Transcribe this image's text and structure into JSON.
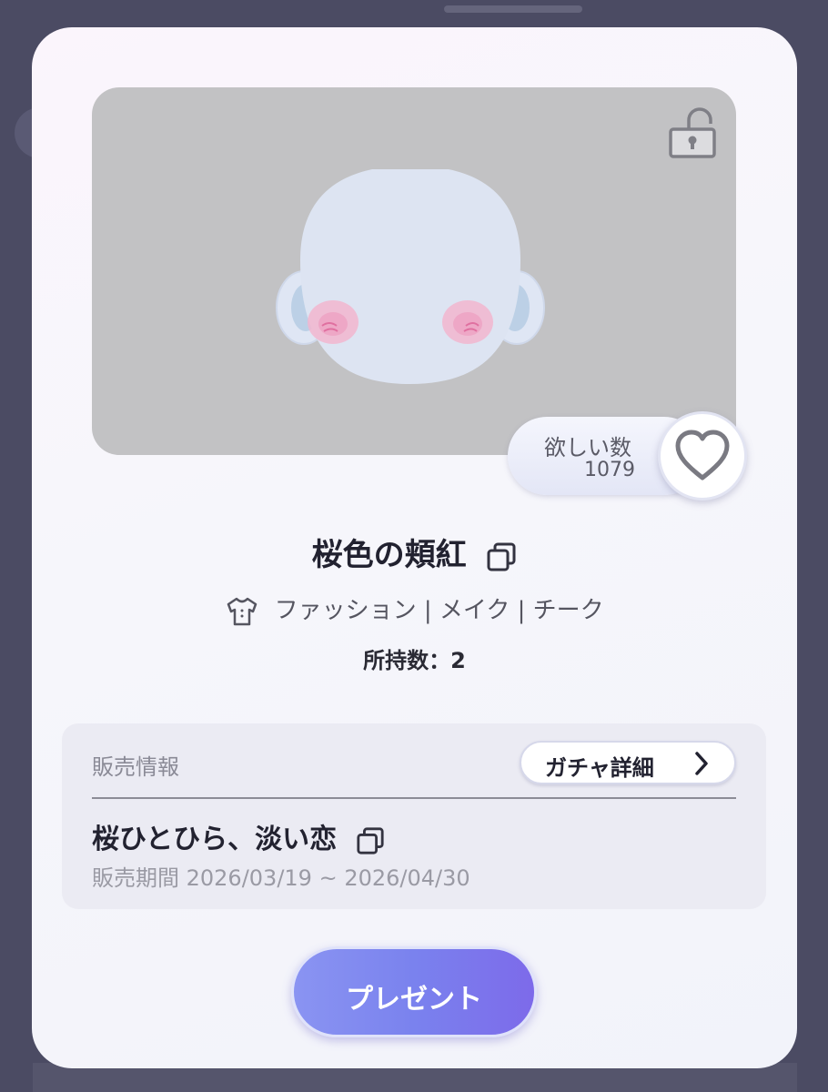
{
  "item": {
    "wish_label": "欲しい数",
    "wish_count": "1079",
    "title": "桜色の頬紅",
    "category": "ファッション | メイク | チーク",
    "owned": "所持数：2"
  },
  "sales": {
    "section_label": "販売情報",
    "gacha_button_label": "ガチャ詳細",
    "gacha_name": "桜ひとひら、淡い恋",
    "period": "販売期間 2026/03/19 ~ 2026/04/30"
  },
  "actions": {
    "present_label": "プレゼント"
  },
  "icons": {
    "lock": "unlocked-padlock-icon",
    "heart": "heart-outline-icon",
    "copy": "copy-icon",
    "category": "shirt-icon",
    "chevron": "chevron-right-icon"
  },
  "colors": {
    "accent_gradient_start": "#8a94f2",
    "accent_gradient_end": "#7d6aea",
    "preview_background": "#c2c2c4",
    "panel_background": "#ebebf3",
    "text_primary": "#222230",
    "text_muted": "#9a9aa4"
  }
}
